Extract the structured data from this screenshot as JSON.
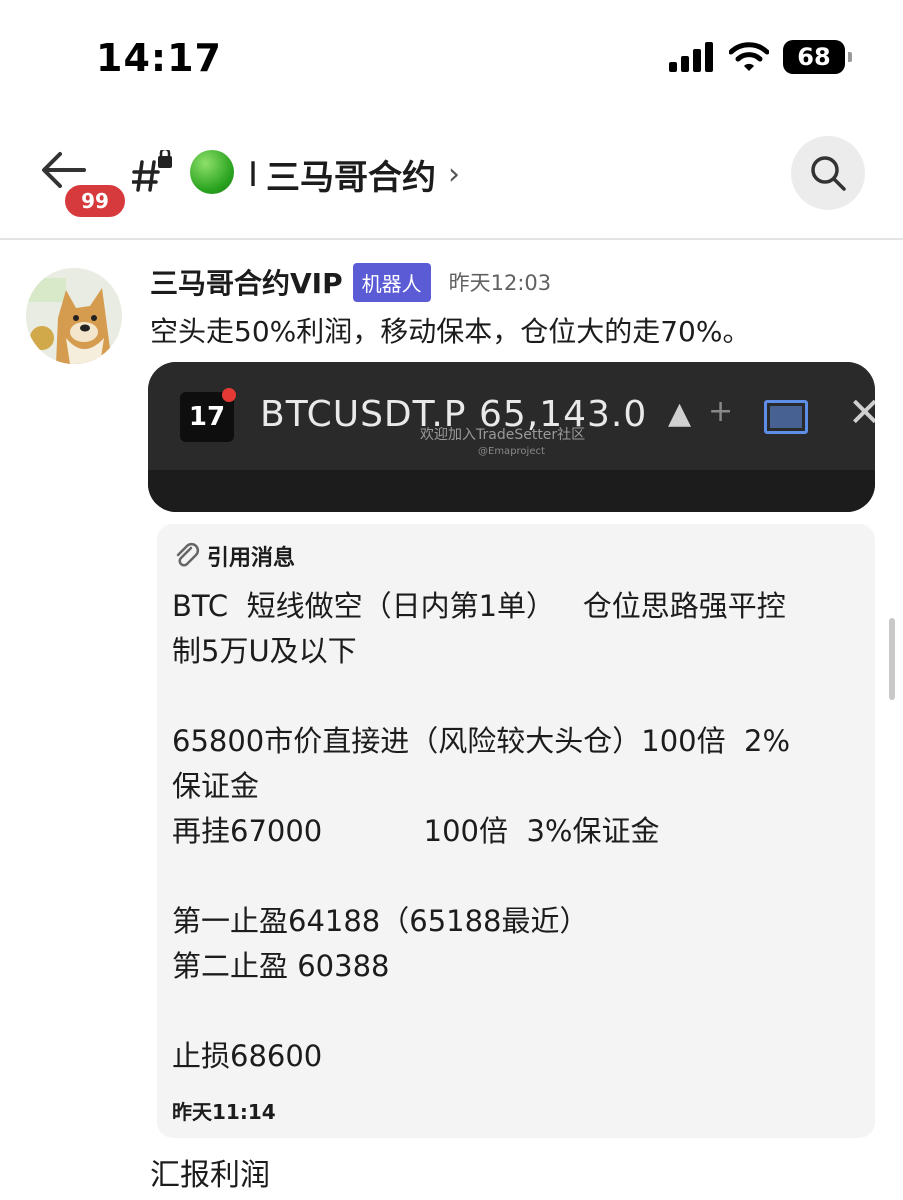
{
  "status_bar": {
    "time": "14:17",
    "battery": "68",
    "icons": [
      "signal-icon",
      "wifi-icon",
      "battery-icon"
    ]
  },
  "header": {
    "back_badge": "99",
    "channel_title": "三马哥合约",
    "channel_prefix": "I",
    "chevron": "›",
    "icons": [
      "back-arrow-icon",
      "hash-lock-icon",
      "green-circle-icon",
      "search-icon"
    ]
  },
  "message": {
    "sender": "三马哥合约VIP",
    "bot_tag": "机器人",
    "time": "昨天12:03",
    "text": "空头走50%利润，移动保本，仓位大的走70%。"
  },
  "chart_screenshot": {
    "logo": "17",
    "ticker": "BTCUSDT.P 65,143.0",
    "up_arrow": "▲",
    "plus": "+",
    "close": "✕",
    "watermark": "欢迎加入TradeSetter社区",
    "watermark_sub": "@Emaproject"
  },
  "quote": {
    "label": "引用消息",
    "lines": [
      "BTC  短线做空（日内第1单）   仓位思路强平控",
      "制5万U及以下",
      "",
      "65800市价直接进（风险较大头仓）100倍  2%",
      "保证金",
      "再挂67000           100倍  3%保证金",
      "",
      "第一止盈64188（65188最近）",
      "第二止盈 60388",
      "",
      "止损68600"
    ],
    "time": "昨天11:14"
  },
  "next_message": {
    "text": "汇报利润"
  },
  "colors": {
    "badge_red": "#d63a3c",
    "bot_tag": "#5b5bd6",
    "quote_bg": "#f4f4f4"
  }
}
